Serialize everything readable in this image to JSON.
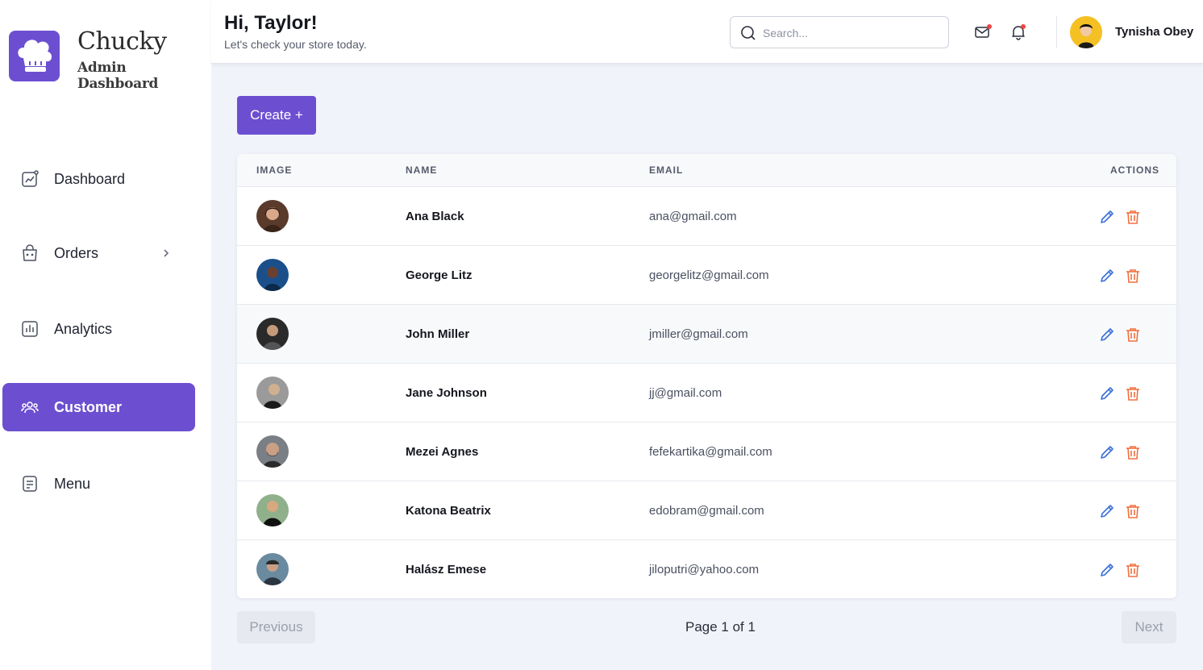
{
  "brand": {
    "name": "Chucky",
    "subtitle": "Admin Dashboard",
    "color": "#6c4fd0"
  },
  "sidebar": {
    "items": [
      {
        "label": "Dashboard",
        "icon": "chart-icon",
        "active": false
      },
      {
        "label": "Orders",
        "icon": "bag-icon",
        "active": false,
        "has_submenu": true
      },
      {
        "label": "Analytics",
        "icon": "bar-chart-icon",
        "active": false
      },
      {
        "label": "Customer",
        "icon": "users-icon",
        "active": true
      },
      {
        "label": "Menu",
        "icon": "list-icon",
        "active": false
      }
    ]
  },
  "header": {
    "greeting": "Hi, Taylor!",
    "subtitle": "Let's check your store today.",
    "search_placeholder": "Search...",
    "user_name": "Tynisha Obey"
  },
  "main": {
    "create_label": "Create +",
    "table": {
      "columns": [
        "IMAGE",
        "NAME",
        "EMAIL",
        "ACTIONS"
      ],
      "rows": [
        {
          "name": "Ana Black",
          "email": "ana@gmail.com"
        },
        {
          "name": "George Litz",
          "email": "georgelitz@gmail.com"
        },
        {
          "name": "John Miller",
          "email": "jmiller@gmail.com"
        },
        {
          "name": "Jane Johnson",
          "email": "jj@gmail.com"
        },
        {
          "name": "Mezei Agnes",
          "email": "fefekartika@gmail.com"
        },
        {
          "name": "Katona Beatrix",
          "email": "edobram@gmail.com"
        },
        {
          "name": "Halász Emese",
          "email": "jiloputri@yahoo.com"
        }
      ]
    },
    "pagination": {
      "previous": "Previous",
      "info": "Page 1 of 1",
      "next": "Next"
    }
  },
  "colors": {
    "accent": "#6c4fd0",
    "edit": "#3b6fd8",
    "delete": "#f07040",
    "badge": "#ef4444"
  }
}
